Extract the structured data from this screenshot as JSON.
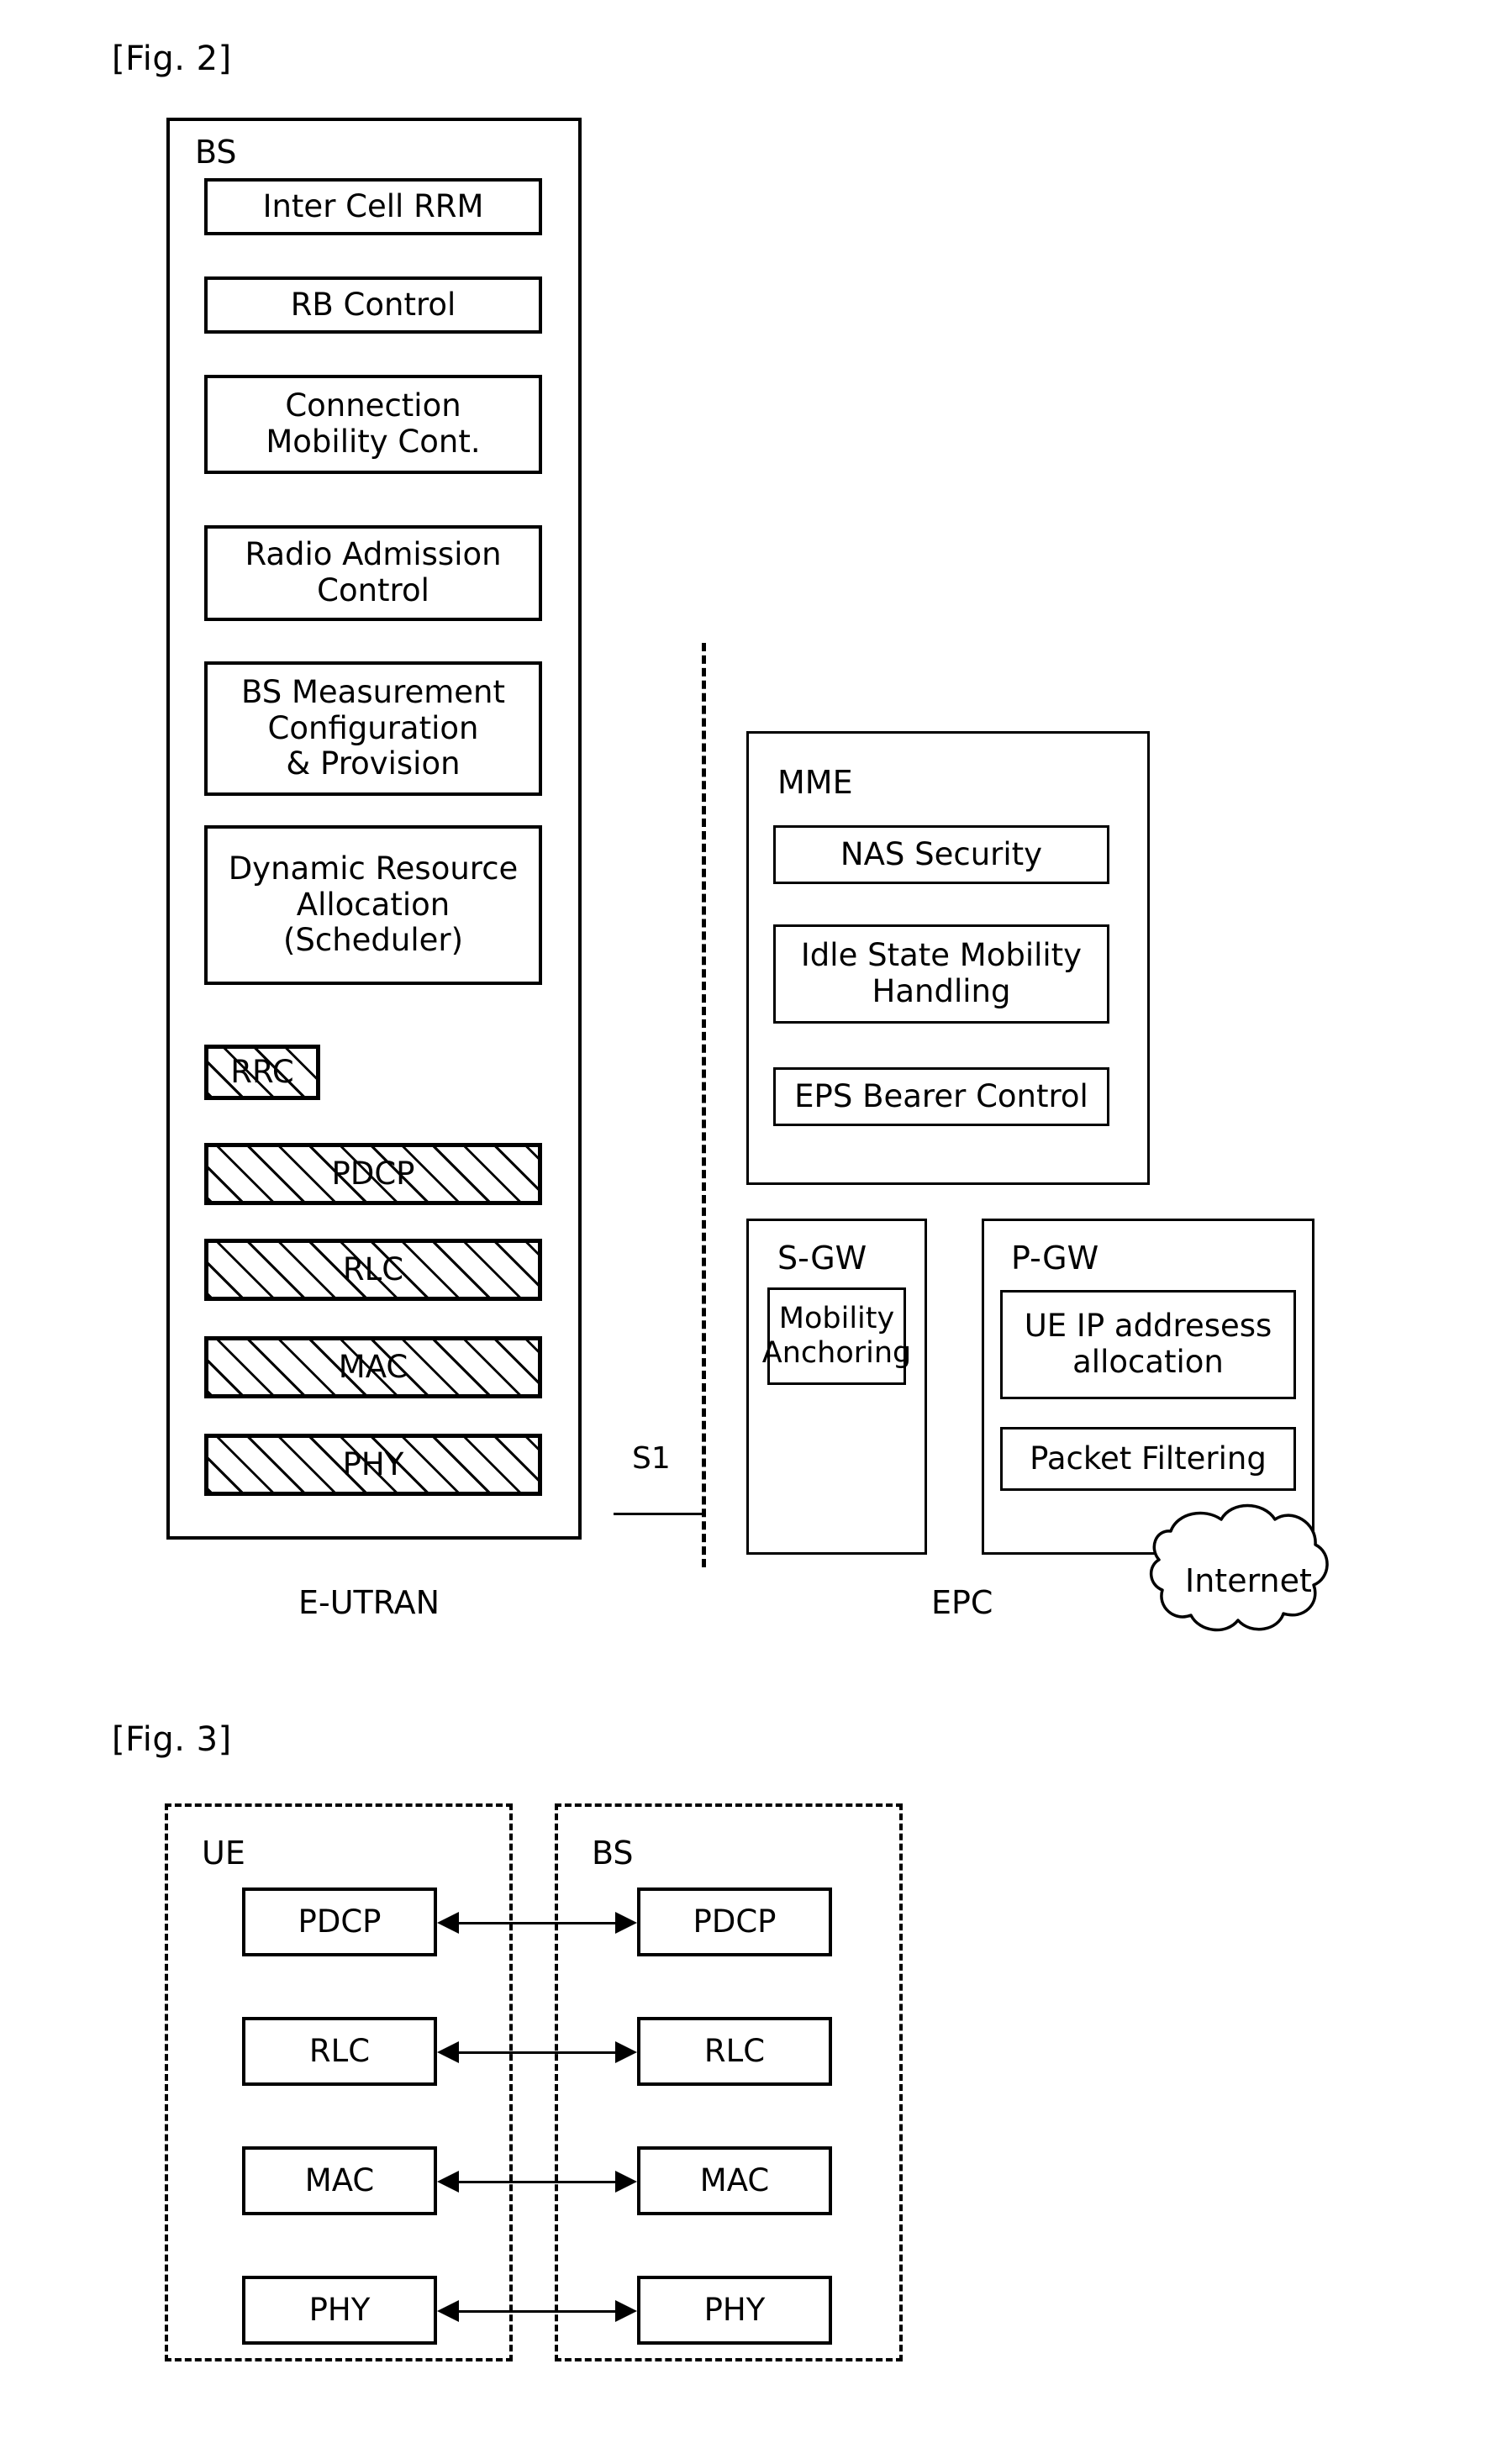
{
  "figures": {
    "fig2": {
      "caption": "[Fig. 2]",
      "bs": {
        "title": "BS",
        "boxes": [
          {
            "label": "Inter Cell RRM"
          },
          {
            "label": "RB Control"
          },
          {
            "label": "Connection\nMobility Cont."
          },
          {
            "label": "Radio Admission\nControl"
          },
          {
            "label": "BS Measurement\nConfiguration\n& Provision"
          },
          {
            "label": "Dynamic Resource\nAllocation\n(Scheduler)"
          }
        ],
        "layers": [
          {
            "label": "RRC"
          },
          {
            "label": "PDCP"
          },
          {
            "label": "RLC"
          },
          {
            "label": "MAC"
          },
          {
            "label": "PHY"
          }
        ]
      },
      "mme": {
        "title": "MME",
        "boxes": [
          {
            "label": "NAS Security"
          },
          {
            "label": "Idle State Mobility\nHandling"
          },
          {
            "label": "EPS Bearer Control"
          }
        ]
      },
      "sgw": {
        "title": "S-GW",
        "boxes": [
          {
            "label": "Mobility\nAnchoring"
          }
        ]
      },
      "pgw": {
        "title": "P-GW",
        "boxes": [
          {
            "label": "UE IP addresess\nallocation"
          },
          {
            "label": "Packet Filtering"
          }
        ]
      },
      "interface_label": "S1",
      "left_domain_label": "E-UTRAN",
      "right_domain_label": "EPC",
      "cloud_label": "Internet"
    },
    "fig3": {
      "caption": "[Fig. 3]",
      "ue": {
        "title": "UE",
        "layers": [
          "PDCP",
          "RLC",
          "MAC",
          "PHY"
        ]
      },
      "bs": {
        "title": "BS",
        "layers": [
          "PDCP",
          "RLC",
          "MAC",
          "PHY"
        ]
      }
    }
  },
  "colors": {
    "stroke": "#000000",
    "background": "#ffffff"
  }
}
